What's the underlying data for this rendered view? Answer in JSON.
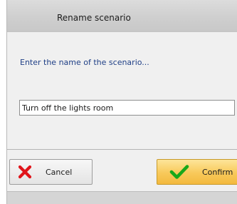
{
  "dialog": {
    "title": "Rename scenario",
    "prompt": "Enter the name of the scenario...",
    "name_field": {
      "value": "Turn off the lights room"
    },
    "buttons": {
      "cancel_label": "Cancel",
      "cancel_icon": "close-x-icon",
      "confirm_label": "Confirm",
      "confirm_icon": "check-icon"
    }
  },
  "colors": {
    "prompt_text": "#1f3f86",
    "cancel_icon": "#e0151b",
    "confirm_icon": "#18a81a",
    "confirm_button": "#f8c95a"
  }
}
